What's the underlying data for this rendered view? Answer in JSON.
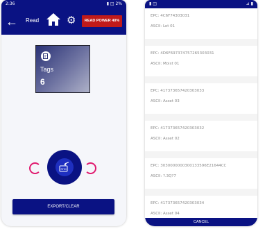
{
  "left_phone": {
    "status_time": "2:36",
    "status_right": "▮ ◫ 2%",
    "toolbar": {
      "title": "Read",
      "power_label": "READ POWER 40%"
    },
    "tags_card": {
      "label": "Tags",
      "count": "6"
    },
    "scan_button_caption": "RFID",
    "export_button": "EXPORT/CLEAR"
  },
  "right_phone": {
    "status_left": "▮ ◫",
    "status_right": "⊿ ▮",
    "tags": [
      {
        "epc": "EPC: 4C6F74303031",
        "ascii": "ASCII: Lot 01"
      },
      {
        "epc": "EPC: 4D6F697374757265303031",
        "ascii": "ASCII: Moist 01"
      },
      {
        "epc": "EPC: 417373657420303033",
        "ascii": "ASCII: Asset 03"
      },
      {
        "epc": "EPC: 417373657420303032",
        "ascii": "ASCII: Asset 02"
      },
      {
        "epc": "EPC: 3030000000300133596E21644CC",
        "ascii": "ASCII: ?.3Q?7"
      },
      {
        "epc": "EPC: 417373657420303034",
        "ascii": "ASCII: Asset 04"
      }
    ],
    "cancel_button": "CANCEL"
  },
  "colors": {
    "primary": "#0a1283",
    "power_badge": "#c01a1a",
    "spinner": "#e0196e"
  }
}
